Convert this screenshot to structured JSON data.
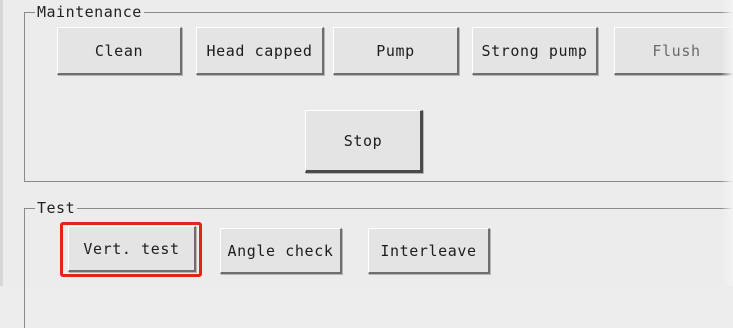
{
  "maintenance": {
    "title": "Maintenance",
    "buttons": {
      "clean": "Clean",
      "head_capped": "Head capped",
      "pump": "Pump",
      "strong_pump": "Strong pump",
      "flush": "Flush",
      "stop": "Stop"
    }
  },
  "test": {
    "title": "Test",
    "buttons": {
      "vert_test": "Vert. test",
      "angle_check": "Angle check",
      "interleave": "Interleave"
    }
  },
  "colors": {
    "highlight": "#e0261b",
    "background": "#ececec"
  }
}
